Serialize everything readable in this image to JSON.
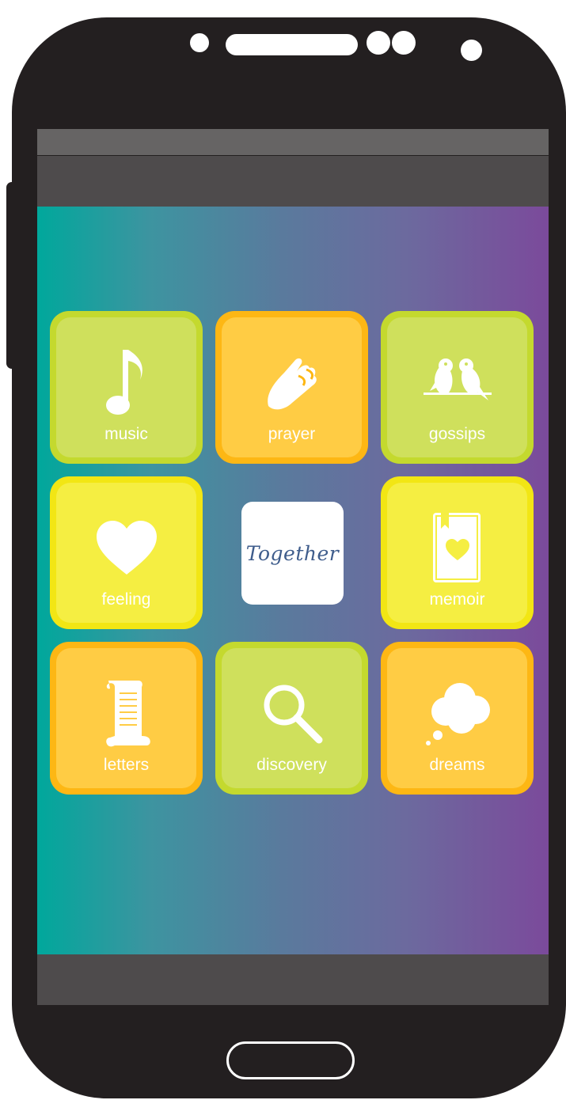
{
  "logo": {
    "text": "Together"
  },
  "tiles": [
    {
      "label": "music",
      "color": "green",
      "icon": "music-note-icon"
    },
    {
      "label": "prayer",
      "color": "orange",
      "icon": "praying-hands-icon"
    },
    {
      "label": "gossips",
      "color": "green",
      "icon": "birds-icon"
    },
    {
      "label": "feeling",
      "color": "yellow",
      "icon": "heart-icon"
    },
    {
      "label": "memoir",
      "color": "yellow",
      "icon": "book-heart-icon"
    },
    {
      "label": "letters",
      "color": "orange",
      "icon": "scroll-icon"
    },
    {
      "label": "discovery",
      "color": "green",
      "icon": "magnifier-icon"
    },
    {
      "label": "dreams",
      "color": "orange",
      "icon": "thought-cloud-icon"
    }
  ],
  "colors": {
    "green": "#c4d92e",
    "orange": "#fdb714",
    "yellow": "#f2e614",
    "gradient_start": "#00a89c",
    "gradient_end": "#7b4a9b",
    "phone_body": "#231f20"
  }
}
